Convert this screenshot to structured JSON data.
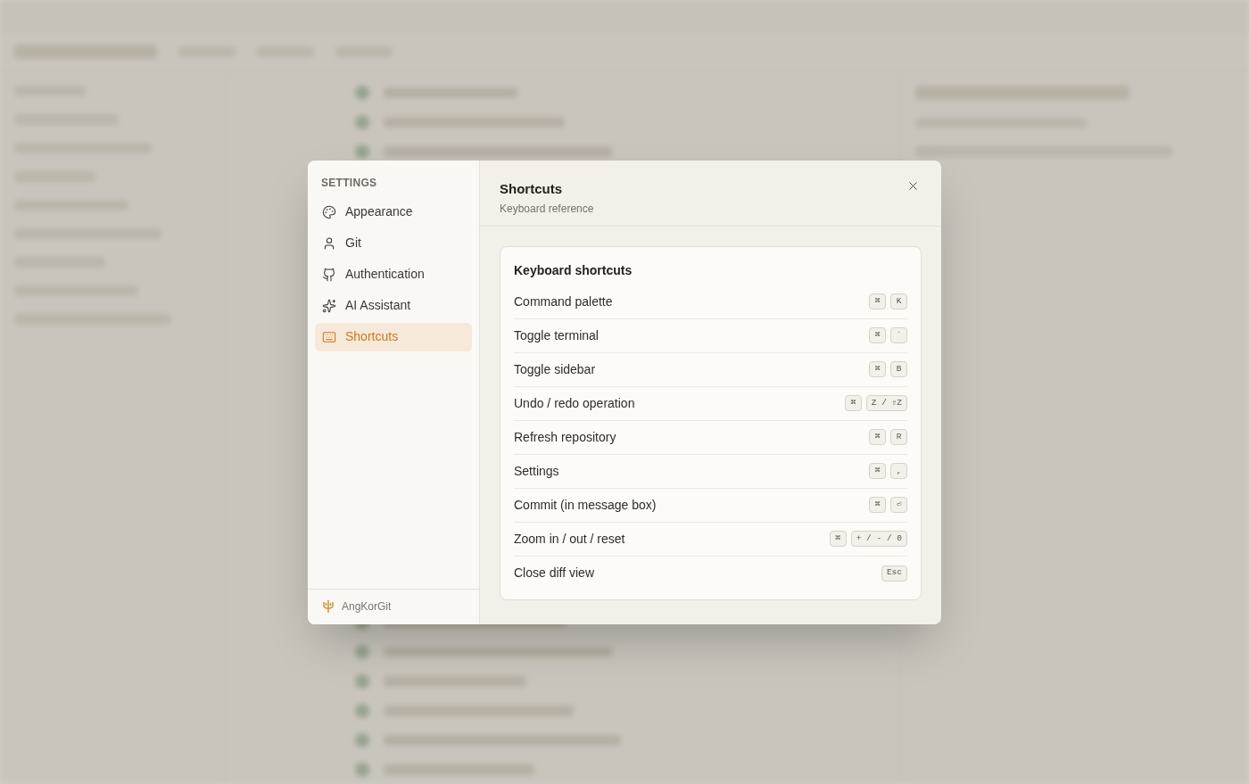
{
  "settings_nav": {
    "heading": "SETTINGS",
    "items": [
      {
        "label": "Appearance",
        "selected": false
      },
      {
        "label": "Git",
        "selected": false
      },
      {
        "label": "Authentication",
        "selected": false
      },
      {
        "label": "AI Assistant",
        "selected": false
      },
      {
        "label": "Shortcuts",
        "selected": true
      }
    ],
    "footer": "AngKorGit"
  },
  "panel": {
    "title": "Shortcuts",
    "subtitle": "Keyboard reference",
    "card_title": "Keyboard shortcuts",
    "shortcuts": [
      {
        "action": "Command palette",
        "keys": [
          "⌘",
          "K"
        ]
      },
      {
        "action": "Toggle terminal",
        "keys": [
          "⌘",
          "`"
        ]
      },
      {
        "action": "Toggle sidebar",
        "keys": [
          "⌘",
          "B"
        ]
      },
      {
        "action": "Undo / redo operation",
        "keys": [
          "⌘",
          "Z / ⇧Z"
        ]
      },
      {
        "action": "Refresh repository",
        "keys": [
          "⌘",
          "R"
        ]
      },
      {
        "action": "Settings",
        "keys": [
          "⌘",
          ","
        ]
      },
      {
        "action": "Commit (in message box)",
        "keys": [
          "⌘",
          "⏎"
        ]
      },
      {
        "action": "Zoom in / out / reset",
        "keys": [
          "⌘",
          "+ / - / 0"
        ]
      },
      {
        "action": "Close diff view",
        "keys": [
          "Esc"
        ]
      }
    ]
  }
}
